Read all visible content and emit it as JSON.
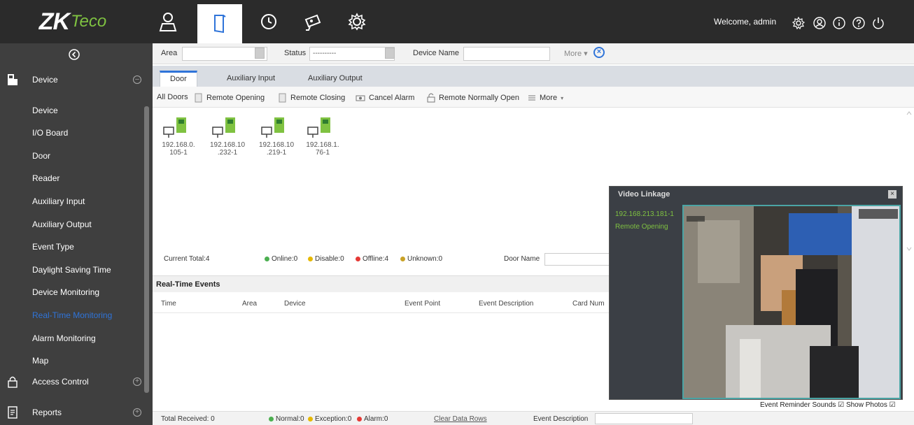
{
  "brand": {
    "zk": "ZK",
    "eco": "Teco"
  },
  "topnav": [
    {
      "name": "personnel-icon"
    },
    {
      "name": "access-door-icon",
      "active": true
    },
    {
      "name": "attendance-clock-icon"
    },
    {
      "name": "video-camera-icon"
    },
    {
      "name": "system-gear-icon"
    }
  ],
  "header": {
    "welcome": "Welcome, admin"
  },
  "sidebar": {
    "device_section": "Device",
    "items": [
      "Device",
      "I/O Board",
      "Door",
      "Reader",
      "Auxiliary Input",
      "Auxiliary Output",
      "Event Type",
      "Daylight Saving Time",
      "Device Monitoring",
      "Real-Time Monitoring",
      "Alarm Monitoring",
      "Map"
    ],
    "current_item": "Real-Time Monitoring",
    "access_control": "Access Control",
    "reports": "Reports"
  },
  "filters": {
    "area_label": "Area",
    "status_label": "Status",
    "status_value": "----------",
    "device_name_label": "Device Name",
    "more": "More"
  },
  "tabs": [
    "Door",
    "Auxiliary Input",
    "Auxiliary Output"
  ],
  "toolbar": {
    "all_doors": "All Doors",
    "remote_opening": "Remote Opening",
    "remote_closing": "Remote Closing",
    "cancel_alarm": "Cancel Alarm",
    "remote_normally_open": "Remote Normally Open",
    "more": "More"
  },
  "doors": [
    "192.168.0.\n105-1",
    "192.168.10\n.232-1",
    "192.168.10\n.219-1",
    "192.168.1.\n76-1"
  ],
  "door_status": {
    "current_total": "Current Total:4",
    "online": "Online:0",
    "disable": "Disable:0",
    "offline": "Offline:4",
    "unknown": "Unknown:0",
    "door_name_label": "Door Name",
    "colors": {
      "online": "#4caf50",
      "disable": "#e6b800",
      "offline": "#e53935",
      "unknown": "#c9a227"
    }
  },
  "realtime": {
    "title": "Real-Time Events",
    "columns": [
      "Time",
      "Area",
      "Device",
      "Event Point",
      "Event Description",
      "Card Num"
    ]
  },
  "bottom": {
    "total_received": "Total Received: 0",
    "normal": "Normal:0",
    "exception": "Exception:0",
    "alarm": "Alarm:0",
    "clear_rows": "Clear Data Rows",
    "event_description_label": "Event Description"
  },
  "video_linkage": {
    "title": "Video Linkage",
    "ip": "192.168.213.181-1",
    "event": "Remote Opening",
    "close": "×"
  },
  "reminder": {
    "event_sounds": "Event Reminder Sounds",
    "show_photos": "Show Photos"
  },
  "colors": {
    "accent": "#2f74d9",
    "brand_green": "#7fc241",
    "sidebar": "#3f3f3f",
    "topbar": "#2b2b2b"
  }
}
